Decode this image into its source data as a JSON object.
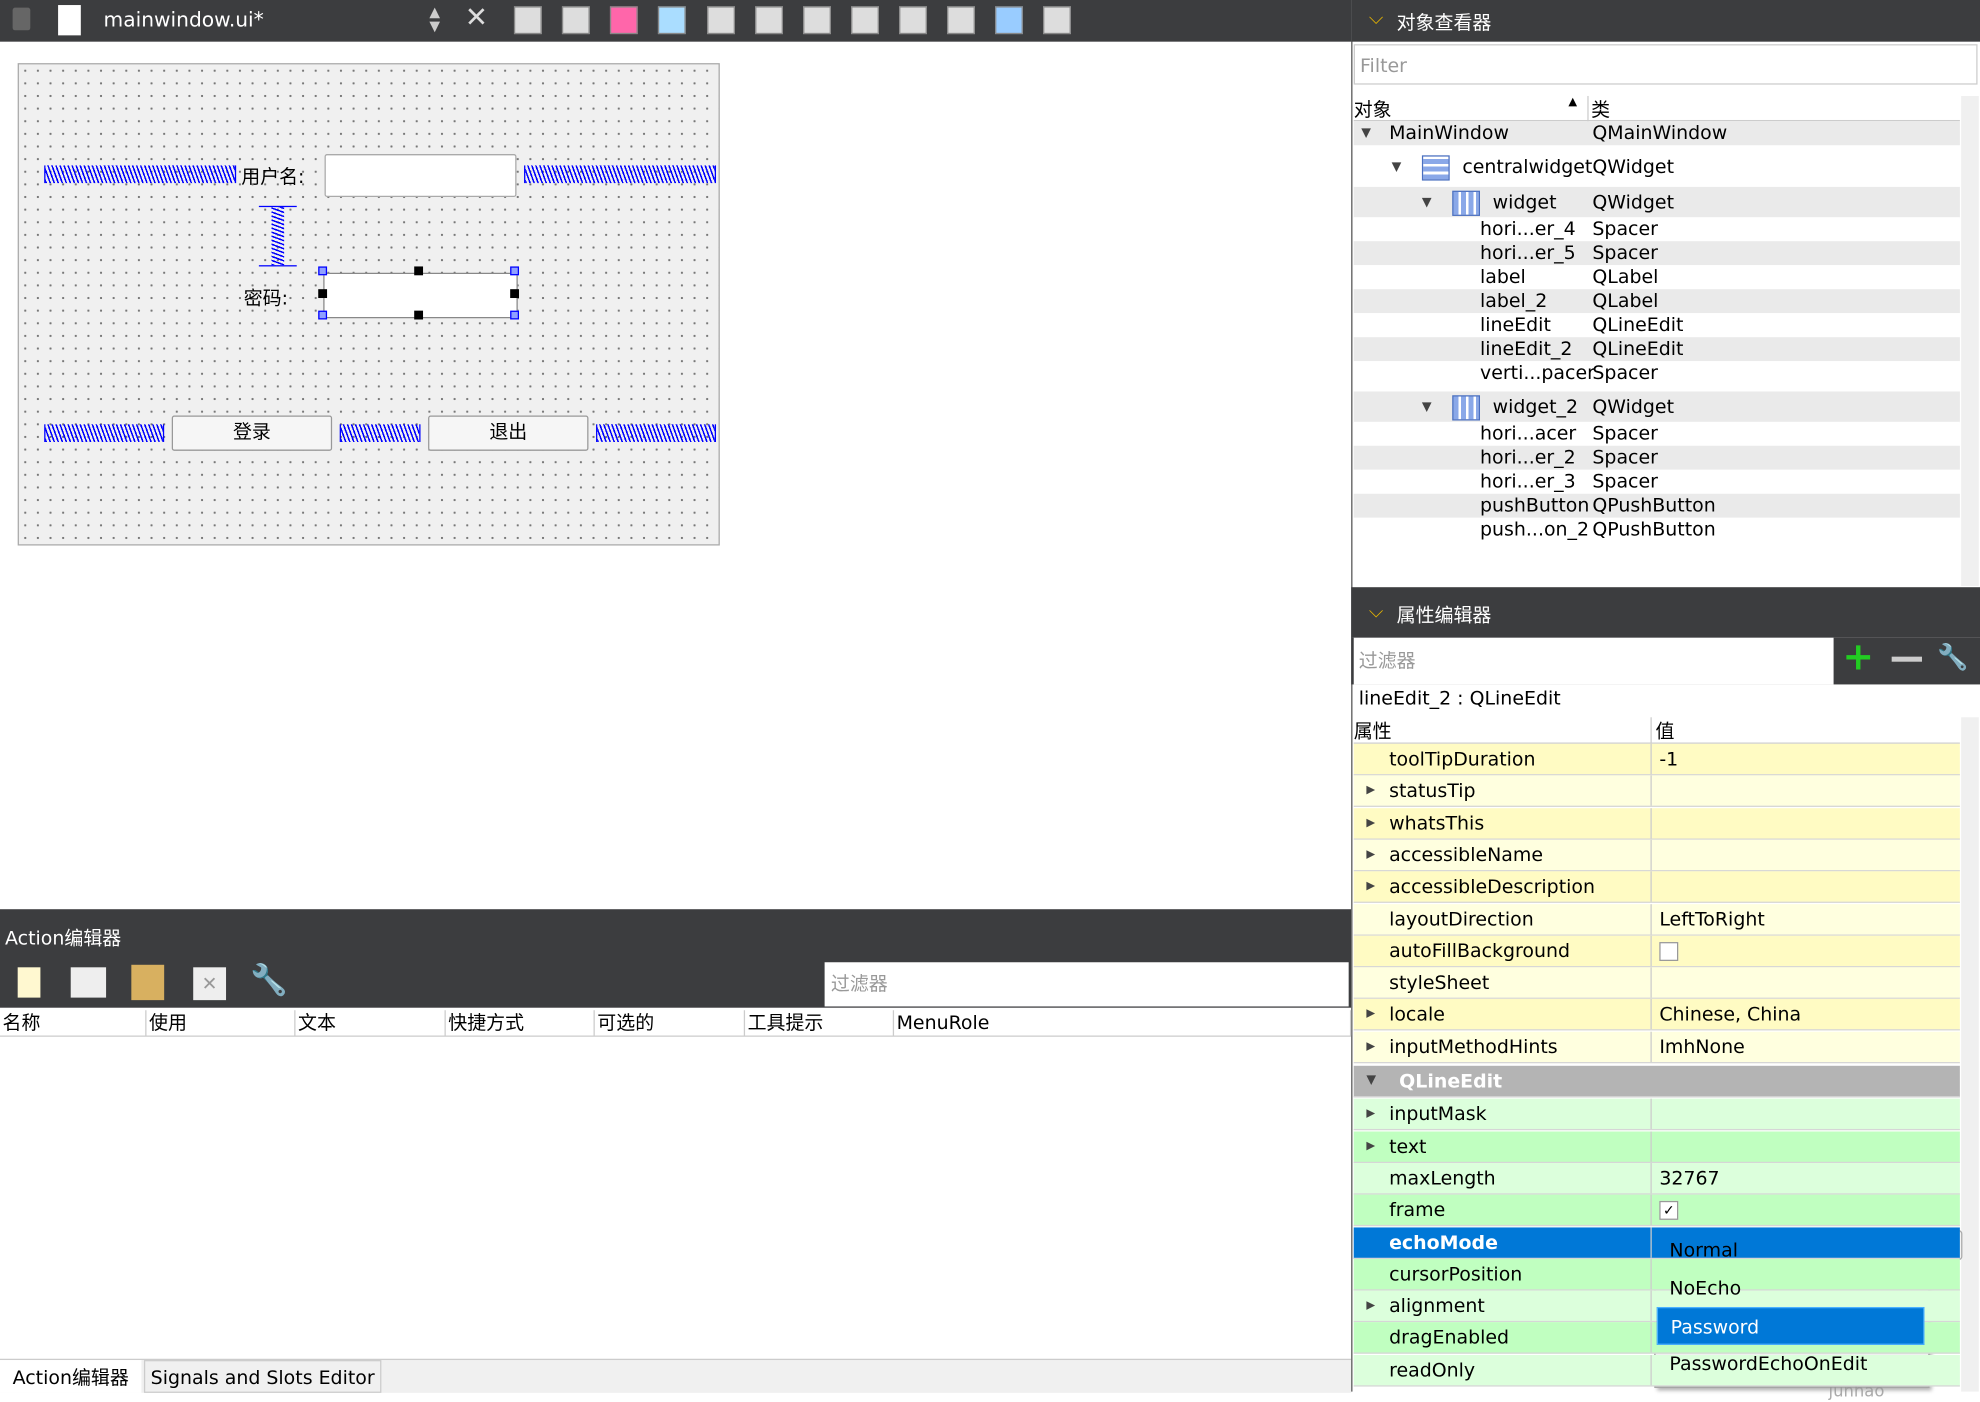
{
  "toolbar": {
    "file_name": "mainwindow.ui*",
    "icons": [
      "lock-icon",
      "edit-file-icon",
      "close-icon",
      "edit-widgets-icon",
      "edit-signals-slots-icon",
      "edit-buddies-icon",
      "edit-tab-order-icon",
      "layout-horizontal-icon",
      "layout-vertical-icon",
      "split-horizontal-icon",
      "split-vertical-icon",
      "layout-form-icon",
      "layout-grid-icon",
      "break-layout-icon",
      "adjust-size-icon"
    ]
  },
  "form": {
    "username_label": "用户名:",
    "password_label": "密码:",
    "login_button": "登录",
    "exit_button": "退出"
  },
  "action_editor": {
    "title": "Action编辑器",
    "filter_placeholder": "过滤器",
    "columns": [
      "名称",
      "使用",
      "文本",
      "快捷方式",
      "可选的",
      "工具提示",
      "MenuRole"
    ],
    "icons": [
      "new-action-icon",
      "copy-icon",
      "paste-icon",
      "delete-icon",
      "settings-wrench-icon"
    ]
  },
  "bottom_tabs": [
    "Action编辑器",
    "Signals and Slots Editor"
  ],
  "object_inspector": {
    "title": "对象查看器",
    "filter_placeholder": "Filter",
    "col_object": "对象",
    "col_class": "类",
    "rows": [
      {
        "name": "MainWindow",
        "class": "QMainWindow",
        "level": 0,
        "expand": true
      },
      {
        "name": "centralwidget",
        "class": "QWidget",
        "level": 1,
        "expand": true,
        "icon": "vertical-layout-icon"
      },
      {
        "name": "widget",
        "class": "QWidget",
        "level": 2,
        "expand": true,
        "icon": "grid-layout-icon"
      },
      {
        "name": "hori...er_4",
        "class": "Spacer",
        "level": 3
      },
      {
        "name": "hori...er_5",
        "class": "Spacer",
        "level": 3
      },
      {
        "name": "label",
        "class": "QLabel",
        "level": 3
      },
      {
        "name": "label_2",
        "class": "QLabel",
        "level": 3
      },
      {
        "name": "lineEdit",
        "class": "QLineEdit",
        "level": 3
      },
      {
        "name": "lineEdit_2",
        "class": "QLineEdit",
        "level": 3
      },
      {
        "name": "verti...pacer",
        "class": "Spacer",
        "level": 3
      },
      {
        "name": "widget_2",
        "class": "QWidget",
        "level": 2,
        "expand": true,
        "icon": "horizontal-layout-icon"
      },
      {
        "name": "hori...acer",
        "class": "Spacer",
        "level": 3
      },
      {
        "name": "hori...er_2",
        "class": "Spacer",
        "level": 3
      },
      {
        "name": "hori...er_3",
        "class": "Spacer",
        "level": 3
      },
      {
        "name": "pushButton",
        "class": "QPushButton",
        "level": 3
      },
      {
        "name": "push...on_2",
        "class": "QPushButton",
        "level": 3
      }
    ]
  },
  "property_editor": {
    "title": "属性编辑器",
    "filter_placeholder": "过滤器",
    "object_label": "lineEdit_2 : QLineEdit",
    "col_property": "属性",
    "col_value": "值",
    "rows": [
      {
        "name": "toolTipDuration",
        "value": "-1",
        "group": "y"
      },
      {
        "name": "statusTip",
        "value": "",
        "group": "y",
        "expandable": true
      },
      {
        "name": "whatsThis",
        "value": "",
        "group": "y",
        "expandable": true
      },
      {
        "name": "accessibleName",
        "value": "",
        "group": "y",
        "expandable": true
      },
      {
        "name": "accessibleDescription",
        "value": "",
        "group": "y",
        "expandable": true
      },
      {
        "name": "layoutDirection",
        "value": "LeftToRight",
        "group": "y"
      },
      {
        "name": "autoFillBackground",
        "value": "",
        "group": "y",
        "checkbox": false
      },
      {
        "name": "styleSheet",
        "value": "",
        "group": "y"
      },
      {
        "name": "locale",
        "value": "Chinese, China",
        "group": "y",
        "expandable": true
      },
      {
        "name": "inputMethodHints",
        "value": "ImhNone",
        "group": "y",
        "expandable": true
      },
      {
        "name": "QLineEdit",
        "value": "",
        "group": "header"
      },
      {
        "name": "inputMask",
        "value": "",
        "group": "g",
        "expandable": true
      },
      {
        "name": "text",
        "value": "",
        "group": "g",
        "expandable": true
      },
      {
        "name": "maxLength",
        "value": "32767",
        "group": "g"
      },
      {
        "name": "frame",
        "value": "",
        "group": "g",
        "checkbox": true
      },
      {
        "name": "echoMode",
        "value": "",
        "group": "sel"
      },
      {
        "name": "cursorPosition",
        "value": "",
        "group": "g"
      },
      {
        "name": "alignment",
        "value": "",
        "group": "g",
        "expandable": true
      },
      {
        "name": "dragEnabled",
        "value": "",
        "group": "g"
      },
      {
        "name": "readOnly",
        "value": "",
        "group": "g"
      }
    ],
    "dropdown": {
      "options": [
        "Normal",
        "NoEcho",
        "Password",
        "PasswordEchoOnEdit"
      ],
      "selected": "Password"
    }
  },
  "watermark": "CSDN @Cai junhao",
  "colors": {
    "selection": "#0078d7",
    "yellow_a": "#fffbc3",
    "yellow_b": "#ffffdf",
    "green_a": "#c0ffc0",
    "green_b": "#dcffdc",
    "panel_dark": "#3c3d3f"
  }
}
